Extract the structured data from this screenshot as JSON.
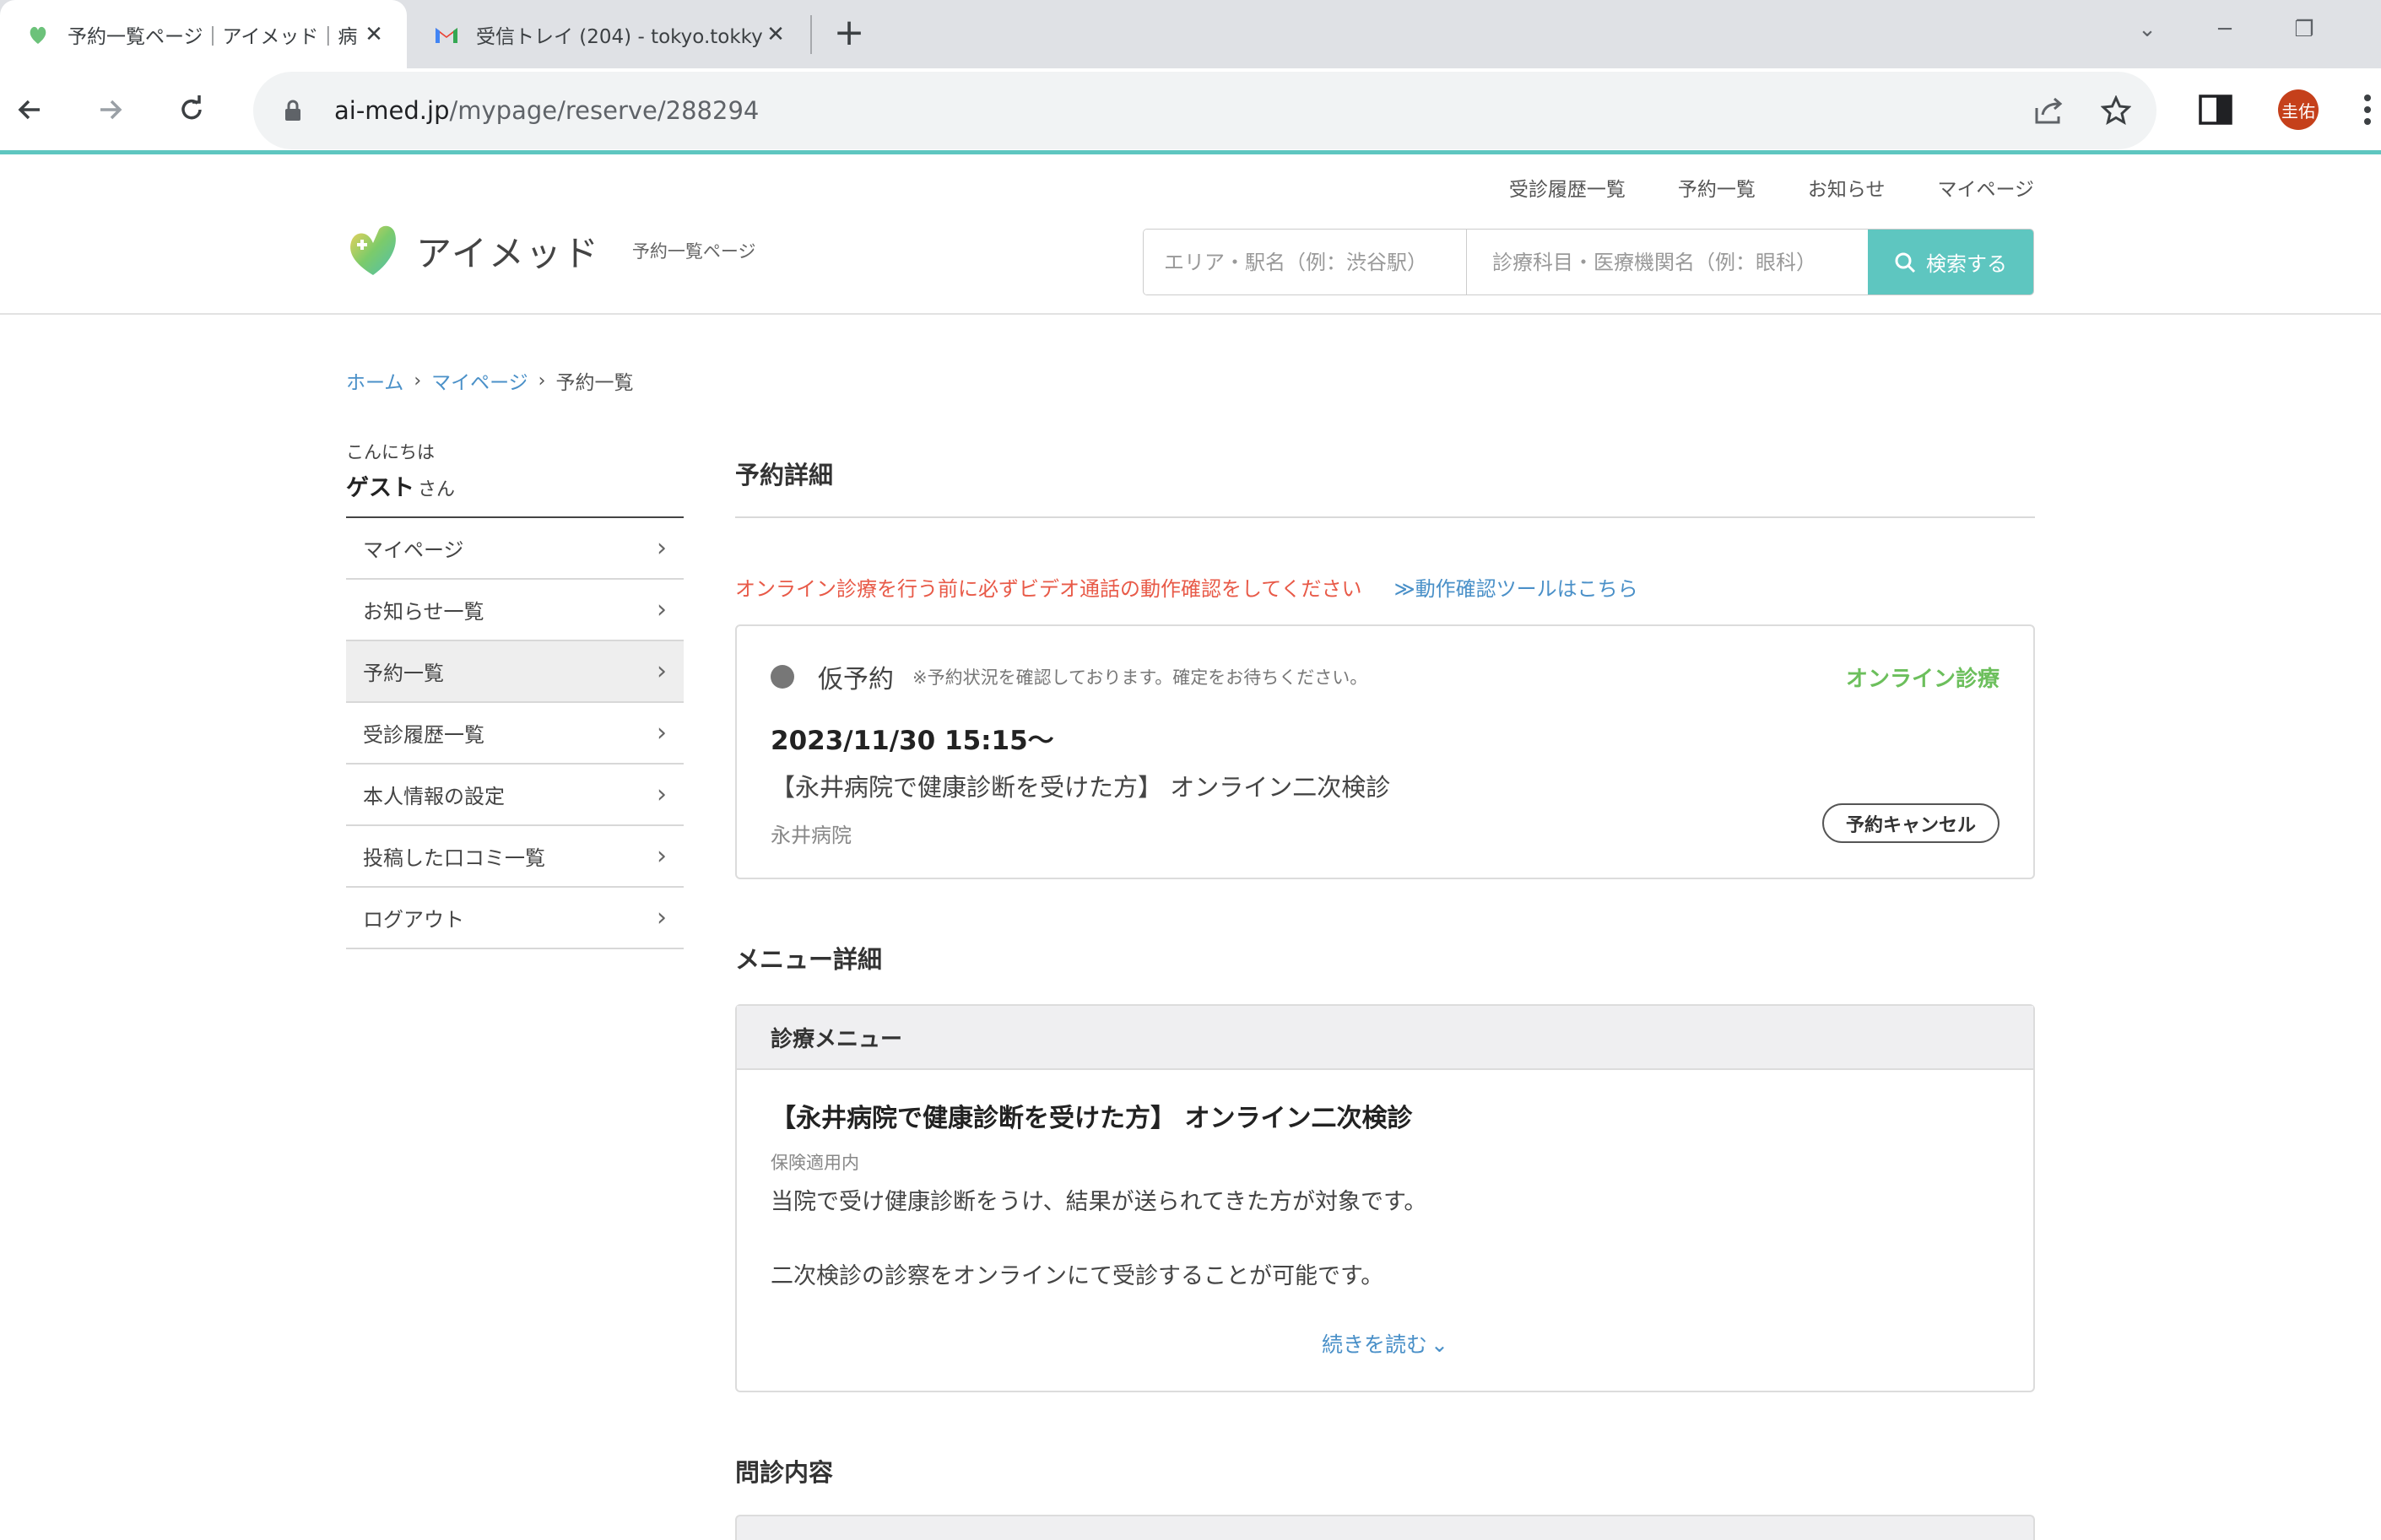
{
  "browser": {
    "tabs": [
      {
        "title": "予約一覧ページ｜アイメッド｜病",
        "active": true
      },
      {
        "title": "受信トレイ (204) - tokyo.tokkyo",
        "active": false
      }
    ],
    "url_domain": "ai-med.jp",
    "url_path": "/mypage/reserve/288294",
    "profile_initials": "圭佑",
    "accent_color": "#5ec6c0"
  },
  "site": {
    "brand": "アイメッド",
    "page_label": "予約一覧ページ",
    "top_nav": [
      "受診履歴一覧",
      "予約一覧",
      "お知らせ",
      "マイページ"
    ],
    "search": {
      "area_placeholder": "エリア・駅名（例：渋谷駅）",
      "dept_placeholder": "診療科目・医療機関名（例：眼科）",
      "button_label": "検索する"
    }
  },
  "breadcrumb": {
    "home": "ホーム",
    "mypage": "マイページ",
    "current": "予約一覧"
  },
  "sidebar": {
    "greeting": "こんにちは",
    "user_name": "ゲスト",
    "honorific": "さん",
    "items": [
      {
        "label": "マイページ"
      },
      {
        "label": "お知らせ一覧"
      },
      {
        "label": "予約一覧",
        "active": true
      },
      {
        "label": "受診履歴一覧"
      },
      {
        "label": "本人情報の設定"
      },
      {
        "label": "投稿した口コミ一覧"
      },
      {
        "label": "ログアウト"
      }
    ]
  },
  "reservation": {
    "section_title": "予約詳細",
    "notice_text": "オンライン診療を行う前に必ずビデオ通話の動作確認をしてください",
    "notice_link": "≫動作確認ツールはこちら",
    "status_label": "仮予約",
    "status_note": "※予約状況を確認しております。確定をお待ちください。",
    "visit_type": "オンライン診療",
    "datetime": "2023/11/30 15:15～",
    "menu_name": "【永井病院で健康診断を受けた方】 オンライン二次検診",
    "hospital": "永井病院",
    "cancel_label": "予約キャンセル"
  },
  "menu_detail": {
    "section_title": "メニュー詳細",
    "card_header": "診療メニュー",
    "menu_name": "【永井病院で健康診断を受けた方】 オンライン二次検診",
    "insurance": "保険適用内",
    "desc_line1": "当院で受け健康診断をうけ、結果が送られてきた方が対象です。",
    "desc_line2": "二次検診の診察をオンラインにて受診することが可能です。",
    "read_more": "続きを読む"
  },
  "questionnaire": {
    "section_title": "問診内容"
  }
}
